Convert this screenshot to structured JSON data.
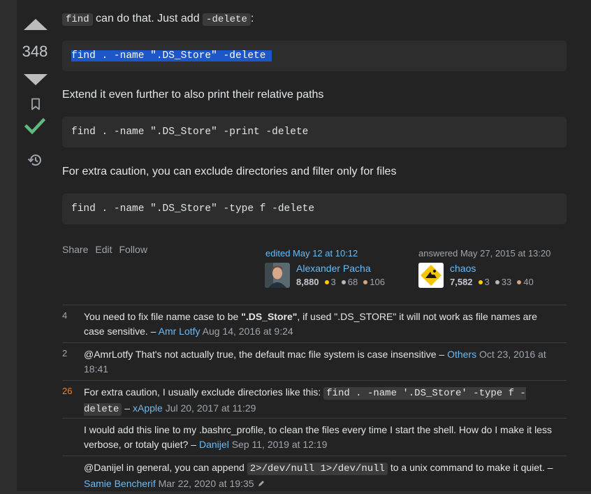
{
  "answer": {
    "vote_count": "348",
    "intro": {
      "code": "find",
      "middle": " can do that. Just add ",
      "code2": "-delete",
      "end": ":"
    },
    "code_blocks": [
      "find . -name \".DS_Store\" -delete ",
      "find . -name \".DS_Store\" -print -delete",
      "find . -name \".DS_Store\" -type f -delete"
    ],
    "paragraphs": [
      "Extend it even further to also print their relative paths",
      "For extra caution, you can exclude directories and filter only for files"
    ],
    "menu": [
      "Share",
      "Edit",
      "Follow"
    ],
    "editor": {
      "action": "edited May 12 at 10:12",
      "name": "Alexander Pacha",
      "rep": "8,880",
      "gold": "3",
      "silver": "68",
      "bronze": "106"
    },
    "author": {
      "action": "answered May 27, 2015 at 13:20",
      "name": "chaos",
      "rep": "7,582",
      "gold": "3",
      "silver": "33",
      "bronze": "40"
    }
  },
  "colors": {
    "gold": "#ffcc01",
    "silver": "#b4b8bc",
    "bronze": "#d1a684",
    "accepted": "#5fba7d",
    "link": "#6cbbf7"
  },
  "comments": [
    {
      "score": "4",
      "pre": "You need to fix file name case to be ",
      "bold": "\".DS_Store\"",
      "post": ", if used \".DS_STORE\" it will not work as file names are case sensitive. – ",
      "user": "Amr Lotfy",
      "date": "Aug 14, 2016 at 9:24"
    },
    {
      "score": "2",
      "text": "@AmrLotfy That's not actually true, the default mac file system is case insensitive – ",
      "user": "Others",
      "date": "Oct 23, 2016 at 18:41"
    },
    {
      "score": "26",
      "text": "For extra caution, I usually exclude directories like this: ",
      "code": "find . -name '.DS_Store' -type f -delete",
      "post": " – ",
      "user": "xApple",
      "date": "Jul 20, 2017 at 11:29"
    },
    {
      "score": "",
      "text": "I would add this line to my .bashrc_profile, to clean the files every time I start the shell. How do I make it less verbose, or totaly quiet? – ",
      "user": "Danijel",
      "date": "Sep 11, 2019 at 12:19"
    },
    {
      "score": "",
      "text": "@Danijel in general, you can append ",
      "code": "2>/dev/null 1>/dev/null",
      "post": " to a unix command to make it quiet. – ",
      "user": "Samie Bencherif",
      "date": "Mar 22, 2020 at 19:35"
    }
  ]
}
